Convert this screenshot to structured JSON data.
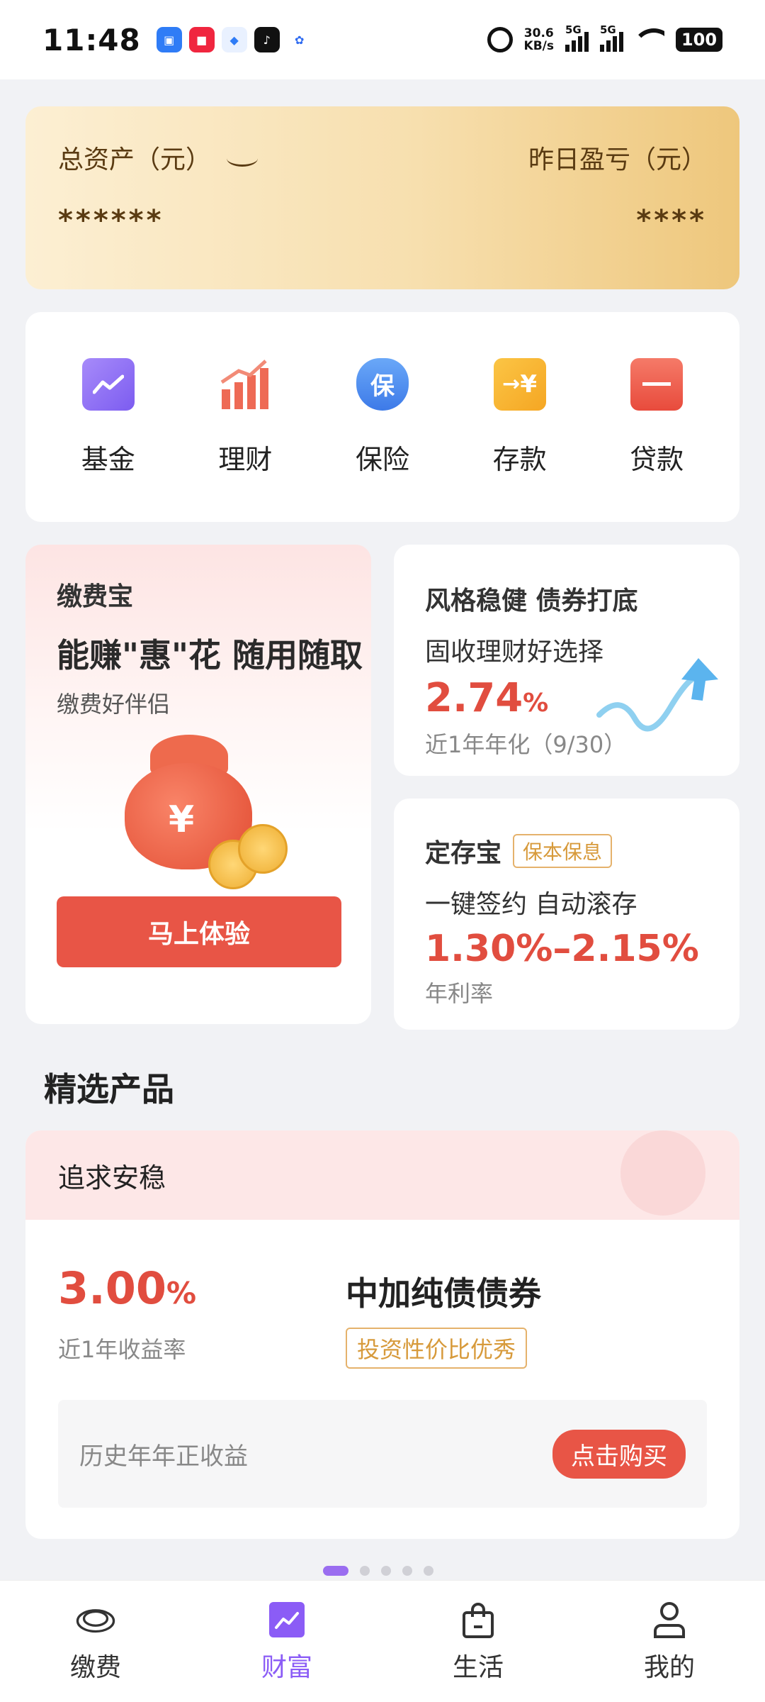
{
  "status": {
    "time": "11:48",
    "net_speed_value": "30.6",
    "net_speed_unit": "KB/s",
    "signal1": "5G",
    "signal2": "5G",
    "battery": "100"
  },
  "asset": {
    "total_label": "总资产（元）",
    "total_value": "******",
    "yesterday_label": "昨日盈亏（元）",
    "yesterday_value": "****"
  },
  "categories": [
    {
      "label": "基金",
      "icon": "chart-icon",
      "color": "#8b6cf6"
    },
    {
      "label": "理财",
      "icon": "bar-chart-icon",
      "color": "#ee6a55"
    },
    {
      "label": "保险",
      "icon": "shield-icon",
      "color": "#4a8df0",
      "glyph": "保"
    },
    {
      "label": "存款",
      "icon": "deposit-icon",
      "color": "#f7b330",
      "glyph": "¥"
    },
    {
      "label": "贷款",
      "icon": "briefcase-icon",
      "color": "#ee5a4a"
    }
  ],
  "promo_left": {
    "title": "缴费宝",
    "headline": "能赚\"惠\"花  随用随取",
    "subtitle": "缴费好伴侣",
    "button": "马上体验"
  },
  "promo_right1": {
    "title": "风格稳健 债券打底",
    "line": "固收理财好选择",
    "rate": "2.74",
    "rate_unit": "%",
    "note": "近1年年化（9/30）"
  },
  "promo_right2": {
    "title": "定存宝",
    "tag": "保本保息",
    "line": "一键签约 自动滚存",
    "rate": "1.30%–2.15%",
    "note": "年利率"
  },
  "section": {
    "title": "精选产品"
  },
  "product": {
    "header": "追求安稳",
    "rate": "3.00",
    "rate_unit": "%",
    "rate_label": "近1年收益率",
    "name": "中加纯债债券",
    "tag": "投资性价比优秀",
    "strip_text": "历史年年正收益",
    "buy": "点击购买"
  },
  "pager": {
    "count": 5,
    "active": 0
  },
  "nav": [
    {
      "label": "缴费",
      "icon": "payment-icon"
    },
    {
      "label": "财富",
      "icon": "wealth-icon",
      "active": true
    },
    {
      "label": "生活",
      "icon": "shopping-bag-icon"
    },
    {
      "label": "我的",
      "icon": "user-icon"
    }
  ],
  "colors": {
    "accent": "#8b5cf6",
    "red": "#e14d3f",
    "gold": "#d79a3b"
  }
}
